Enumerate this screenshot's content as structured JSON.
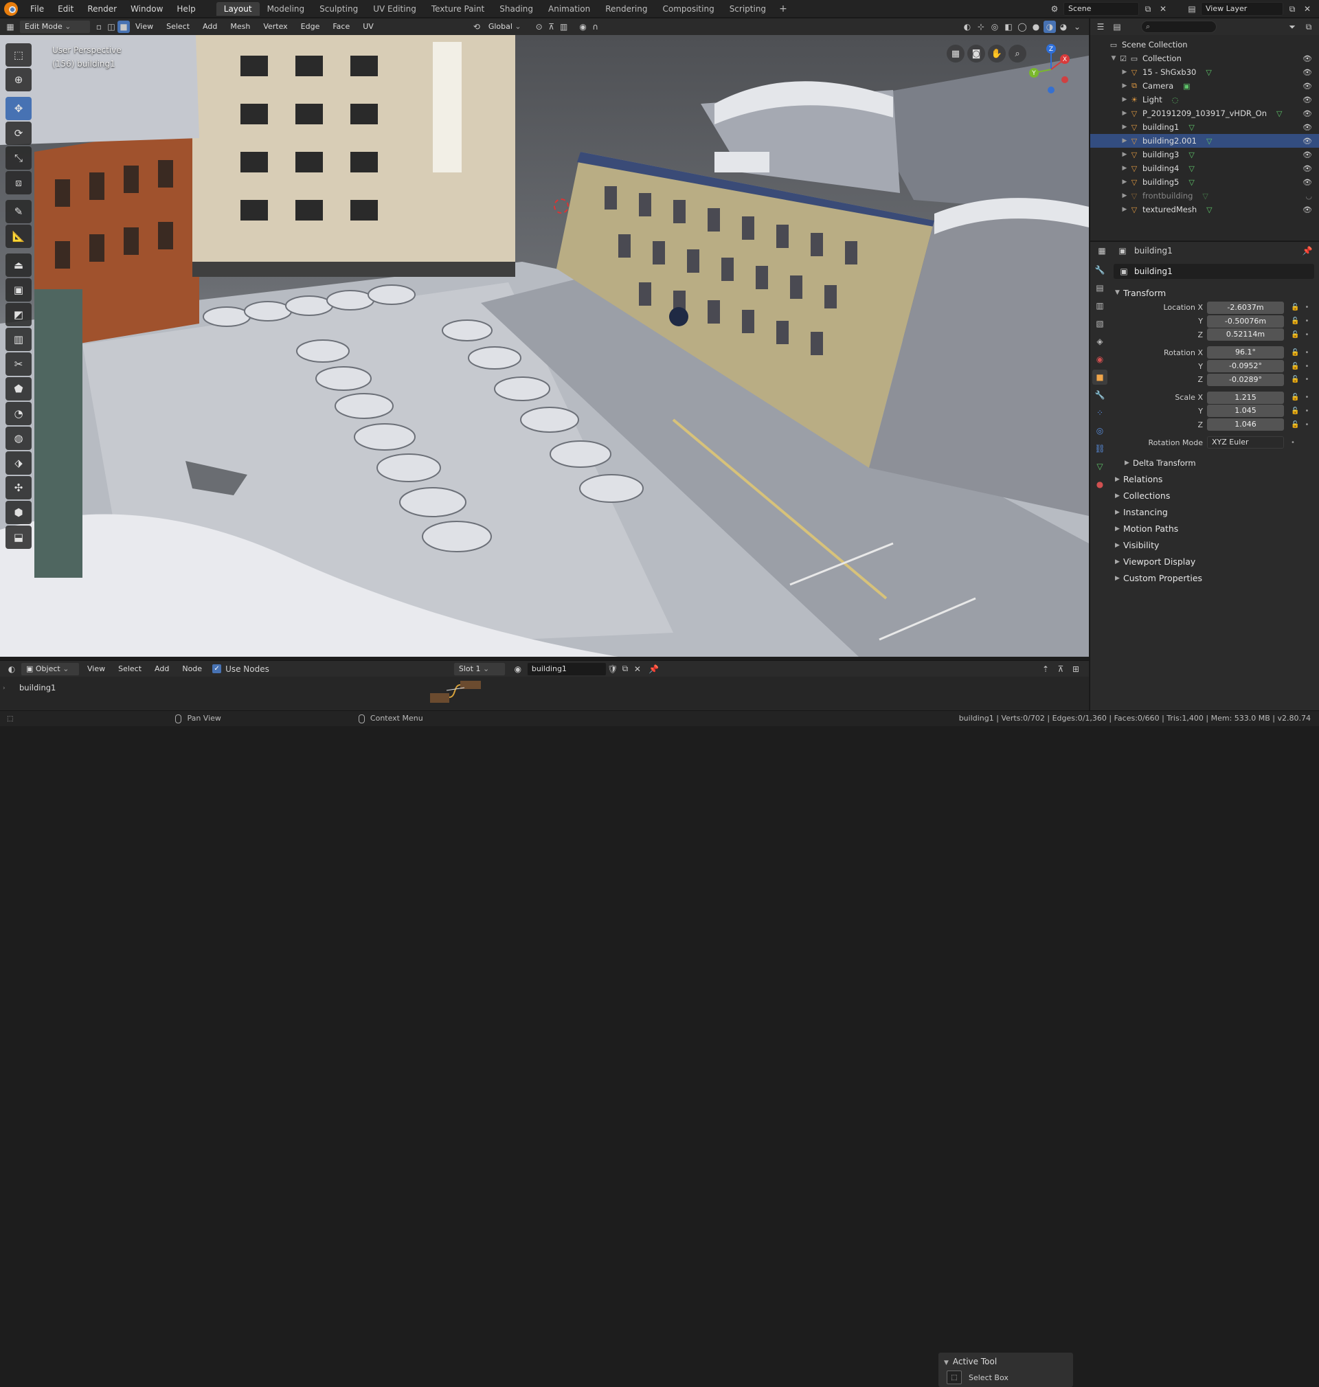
{
  "menu": [
    "File",
    "Edit",
    "Render",
    "Window",
    "Help"
  ],
  "workspaces": [
    "Layout",
    "Modeling",
    "Sculpting",
    "UV Editing",
    "Texture Paint",
    "Shading",
    "Animation",
    "Rendering",
    "Compositing",
    "Scripting"
  ],
  "workspace_add": "+",
  "scene": "Scene",
  "view_layer": "View Layer",
  "viewport_header": {
    "mode": "Edit Mode",
    "menus": [
      "View",
      "Select",
      "Add",
      "Mesh",
      "Vertex",
      "Edge",
      "Face",
      "UV"
    ],
    "transform_orientation": "Global"
  },
  "viewport": {
    "perspective": "User Perspective",
    "object_info": "(156) building1"
  },
  "gizmo_axes": {
    "x": "X",
    "y": "Y",
    "z": "Z"
  },
  "outliner": {
    "root": "Scene Collection",
    "collection": "Collection",
    "items": [
      {
        "name": "15 - ShGxb30"
      },
      {
        "name": "Camera"
      },
      {
        "name": "Light"
      },
      {
        "name": "P_20191209_103917_vHDR_On"
      },
      {
        "name": "building1"
      },
      {
        "name": "building2.001"
      },
      {
        "name": "building3"
      },
      {
        "name": "building4"
      },
      {
        "name": "building5"
      },
      {
        "name": "frontbuilding"
      },
      {
        "name": "texturedMesh"
      }
    ]
  },
  "properties": {
    "header_object": "building1",
    "name_field": "building1",
    "transform_title": "Transform",
    "location_label": "Location X",
    "location": {
      "x": "-2.6037m",
      "y": "-0.50076m",
      "z": "0.52114m"
    },
    "rotation_label": "Rotation X",
    "rotation": {
      "x": "96.1°",
      "y": "-0.0952°",
      "z": "-0.0289°"
    },
    "scale_label": "Scale X",
    "scale": {
      "x": "1.215",
      "y": "1.045",
      "z": "1.046"
    },
    "axis_y": "Y",
    "axis_z": "Z",
    "rotation_mode_label": "Rotation Mode",
    "rotation_mode": "XYZ Euler",
    "delta_transform": "Delta Transform",
    "panels": [
      "Relations",
      "Collections",
      "Instancing",
      "Motion Paths",
      "Visibility",
      "Viewport Display",
      "Custom Properties"
    ]
  },
  "node_editor": {
    "mode": "Object",
    "menus": [
      "View",
      "Select",
      "Add",
      "Node"
    ],
    "use_nodes": "Use Nodes",
    "slot": "Slot 1",
    "material": "building1",
    "breadcrumb": "building1"
  },
  "active_tool": {
    "title": "Active Tool",
    "tool": "Select Box"
  },
  "status": {
    "pan": "Pan View",
    "context": "Context Menu",
    "stats": "building1 | Verts:0/702 | Edges:0/1,360 | Faces:0/660 | Tris:1,400 | Mem: 533.0 MB | v2.80.74"
  }
}
